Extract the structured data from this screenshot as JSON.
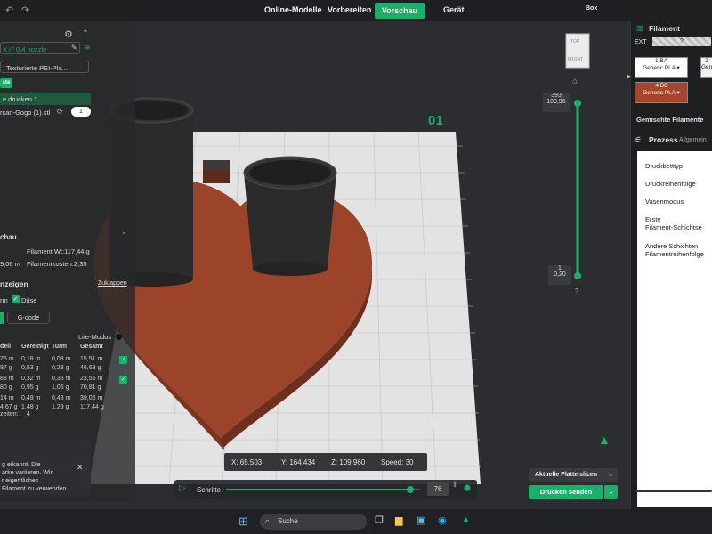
{
  "topbar": {
    "tabs": [
      "Online-Modelle",
      "Vorbereiten",
      "Vorschau",
      "Gerät"
    ],
    "box_label": "Box"
  },
  "left_panel": {
    "printer": "X i7 0.4 nozzle",
    "plate_type": "Texturierte PEI-Pla...",
    "green_btn": "ste",
    "objects": [
      "e drucken 1",
      "rcan-Gogo (1).stl"
    ],
    "object_count": "1",
    "preview_title": "chau",
    "stats_left": [
      "",
      "9,06 m"
    ],
    "stats_right": [
      "Filament Wt:117,44 g",
      "Filamentkosten:2,35"
    ],
    "display_title": "nzeigen",
    "collapse": "Zuklappen",
    "checkboxes": [
      "rm",
      "Düse"
    ],
    "gcode_tab": "G-code",
    "lite_mode": "Lite-Modus",
    "table": {
      "headers": [
        "dell",
        "Gereinigt",
        "Turm",
        "Gesamt"
      ],
      "rows": [
        [
          "26 m",
          "0,18 m",
          "0,08 m",
          "15,51 m"
        ],
        [
          "87 g",
          "0,53 g",
          "0,23 g",
          "46,63 g"
        ],
        [
          "88 m",
          "0,32 m",
          "0,35 m",
          "23,55 m"
        ],
        [
          "80 g",
          "0,95 g",
          "1,06 g",
          "70,81 g"
        ],
        [
          "14 m",
          "0,49 m",
          "0,43 m",
          "39,06 m"
        ],
        [
          "4,67 g",
          "1,48 g",
          "1,29 g",
          "117,44 g"
        ]
      ],
      "footer_label": "zeiten:",
      "footer_value": "4"
    },
    "notice": [
      "g erkannt. Die",
      "arke variieren. Wir",
      "r eigentliches",
      "Filament zu verwenden."
    ]
  },
  "viewport": {
    "plate_number": "01",
    "layer_top": [
      "393",
      "109,96"
    ],
    "layer_bottom": [
      "1",
      "0,20"
    ],
    "view_top": "TOP",
    "view_front": "FRONT"
  },
  "coords": {
    "x": "X: 65,503",
    "y": "Y: 164,434",
    "z": "Z: 109,960",
    "speed": "Speed: 30"
  },
  "timeline": {
    "label": "Schritte",
    "value": "76",
    "progress": 0.95
  },
  "slice_btn": "Aktuelle Platte slicen",
  "print_btn": "Drucken senden",
  "right_panel": {
    "filament_title": "Filament",
    "ext_label": "EXT",
    "ext_value": "?",
    "slots": [
      {
        "num": "1",
        "code": "BA",
        "name": "Generic PLA",
        "color": "#ffffff"
      },
      {
        "num": "2",
        "code": "",
        "name": "Generic",
        "color": "#f2f2f2"
      },
      {
        "num": "4",
        "code": "B0",
        "name": "Generic PLA",
        "color": "#a6452a"
      }
    ],
    "mixed": "Gemischte Filamente",
    "process": "Prozess",
    "process_tab": "Allgemein",
    "items": [
      "Druckbetttyp",
      "Druckreihenfolge",
      "Vasenmodus",
      "Erste\nFilament-Schichtse",
      "Andere Schichten\nFilamentreihenfolge"
    ]
  },
  "taskbar": {
    "search": "Suche"
  }
}
